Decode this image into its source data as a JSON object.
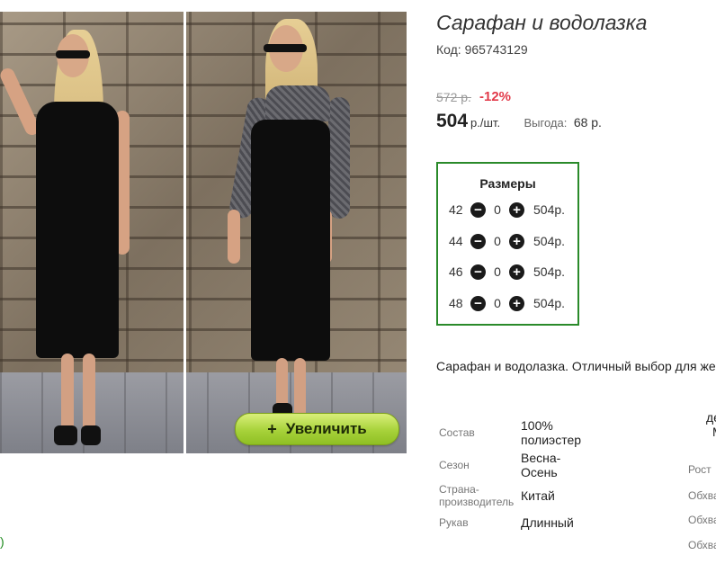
{
  "product": {
    "title": "Сарафан и водолазка",
    "code": "Код: 965743129",
    "old_price": "572 р.",
    "discount": "-12%",
    "price": "504",
    "price_unit": "р./шт.",
    "savings_label": "Выгода:",
    "savings_value": "68 р.",
    "description": "Сарафан и водолазка. Отличный выбор для же"
  },
  "zoom_button": {
    "icon": "+",
    "label": "Увеличить"
  },
  "left_fragment": ")",
  "sizes": {
    "title": "Размеры",
    "rows": [
      {
        "size": "42",
        "qty": "0",
        "price": "504р."
      },
      {
        "size": "44",
        "qty": "0",
        "price": "504р."
      },
      {
        "size": "46",
        "qty": "0",
        "price": "504р."
      },
      {
        "size": "48",
        "qty": "0",
        "price": "504р."
      }
    ],
    "minus_icon": "−",
    "plus_icon": "+"
  },
  "specs": [
    {
      "label": "Состав",
      "value": "100% полиэстер"
    },
    {
      "label": "Сезон",
      "value": "Весна-Осень"
    },
    {
      "label": "Страна-производитель",
      "value": "Китай"
    },
    {
      "label": "Рукав",
      "value": "Длинный"
    }
  ],
  "right_table": {
    "header_frag_1": "де",
    "header_frag_2": "M",
    "labels": [
      "Рост",
      "Обхва",
      "Обхва",
      "Обхва"
    ]
  },
  "colors": {
    "border_green": "#2a8a2a",
    "discount_red": "#e23a4a",
    "button_green": "#a7d23a"
  }
}
